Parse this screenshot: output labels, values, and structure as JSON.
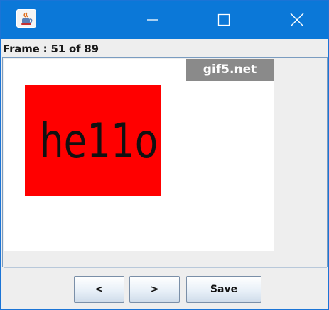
{
  "window": {
    "icon": "java-cup-icon",
    "controls": {
      "minimize": "minimize-icon",
      "maximize": "maximize-icon",
      "close": "close-icon"
    }
  },
  "frame_label": "Frame : 51 of 89",
  "preview": {
    "watermark": "gif5.net",
    "frame_text": "he11o",
    "colors": {
      "frame_box": "#ff0000",
      "watermark_bg": "#8a8a8a",
      "titlebar": "#0b78d8"
    }
  },
  "buttons": {
    "prev": "<",
    "next": ">",
    "save": "Save"
  }
}
